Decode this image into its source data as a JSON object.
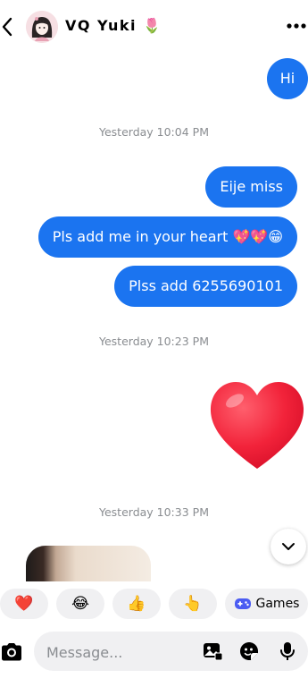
{
  "header": {
    "contact_name": "VQ Yuki 🌷",
    "back_icon": "chevron-left-icon",
    "more_icon": "more-horizontal-icon",
    "brand_color": "#1b74f0"
  },
  "messages": [
    {
      "type": "text",
      "from": "me",
      "text": "Hi"
    },
    {
      "type": "timestamp",
      "text": "Yesterday 10:04 PM"
    },
    {
      "type": "text",
      "from": "me",
      "text": "Eije miss"
    },
    {
      "type": "text",
      "from": "me",
      "text": "Pls add me in your heart 💖💖😁"
    },
    {
      "type": "text",
      "from": "me",
      "text": "Plss add 6255690101"
    },
    {
      "type": "timestamp",
      "text": "Yesterday 10:23 PM"
    },
    {
      "type": "sticker",
      "from": "me",
      "icon": "heart-sticker-icon"
    },
    {
      "type": "timestamp",
      "text": "Yesterday 10:33 PM"
    },
    {
      "type": "photo",
      "from": "them"
    }
  ],
  "quick_replies": {
    "heart": "❤️",
    "laugh": "😂",
    "thumbs_up": "👍",
    "point": "👆",
    "games_label": "Games"
  },
  "composer": {
    "placeholder": "Message...",
    "camera_icon": "camera-icon",
    "gallery_icon": "gallery-icon",
    "sticker_icon": "sticker-icon",
    "mic_icon": "microphone-icon"
  }
}
